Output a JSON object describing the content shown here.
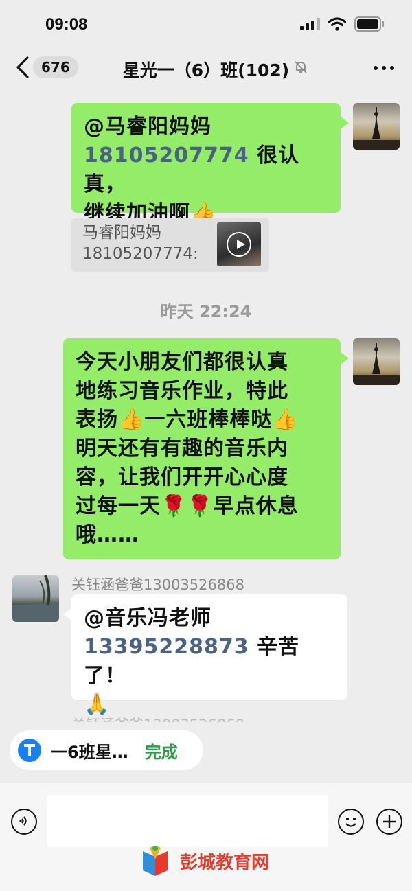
{
  "status_bar": {
    "time": "09:08",
    "icons": [
      "signal-icon",
      "wifi-icon",
      "battery-icon"
    ]
  },
  "nav": {
    "back_icon": "chevron-left-icon",
    "unread_count": "676",
    "title": "星光一（6）班(102)",
    "mute_icon": "bell-off-icon",
    "more_icon": "more-icon"
  },
  "messages": {
    "msg1": {
      "mention": "@马睿阳妈妈",
      "phone": "18105207774",
      "text_a": " 很认真，",
      "text_b": "继续加油啊",
      "emoji": "👍"
    },
    "quote": {
      "line1": "马睿阳妈妈",
      "line2": "18105207774:"
    },
    "timestamp": "昨天 22:24",
    "msg2": {
      "l1": "今天小朋友们都很认真",
      "l2": "地练习音乐作业，特此",
      "l3a": "表扬",
      "l3b": "一六班棒棒哒",
      "l4": "明天还有有趣的音乐内",
      "l5": "容，让我们开开心心度",
      "l6a": "过每一天",
      "l6b": "早点休息",
      "l7": "哦……",
      "thumb": "👍",
      "rose": "🌹"
    },
    "msg3": {
      "sender": "关钰涵爸爸13003526868",
      "mention": "@音乐冯老师",
      "phone": "13395228873",
      "text": " 辛苦了！",
      "emoji": "🙏"
    }
  },
  "pill": {
    "label": "一6班星…",
    "status": "完成",
    "icon": "upload-icon"
  },
  "input_bar": {
    "voice_icon": "voice-icon",
    "emoji_icon": "smiley-icon",
    "plus_icon": "plus-icon",
    "placeholder": ""
  },
  "watermark": {
    "text": "彭城教育网"
  },
  "colors": {
    "bubble_green": "#95ec69",
    "mention_blue": "#4a6284",
    "done_green": "#2e9a4a"
  }
}
